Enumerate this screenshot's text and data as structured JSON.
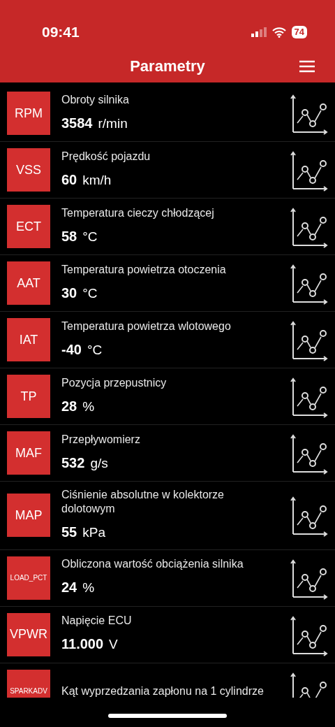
{
  "status_bar": {
    "time": "09:41",
    "battery": "74"
  },
  "header": {
    "title": "Parametry"
  },
  "parameters": [
    {
      "code": "RPM",
      "name": "Obroty silnika",
      "value": "3584",
      "unit": "r/min"
    },
    {
      "code": "VSS",
      "name": "Prędkość pojazdu",
      "value": "60",
      "unit": "km/h"
    },
    {
      "code": "ECT",
      "name": "Temperatura cieczy chłodzącej",
      "value": "58",
      "unit": "°C"
    },
    {
      "code": "AAT",
      "name": "Temperatura powietrza otoczenia",
      "value": "30",
      "unit": "°C"
    },
    {
      "code": "IAT",
      "name": "Temperatura powietrza wlotowego",
      "value": "-40",
      "unit": "°C"
    },
    {
      "code": "TP",
      "name": "Pozycja przepustnicy",
      "value": "28",
      "unit": "%"
    },
    {
      "code": "MAF",
      "name": "Przepływomierz",
      "value": "532",
      "unit": "g/s"
    },
    {
      "code": "MAP",
      "name": "Ciśnienie absolutne w kolektorze dolotowym",
      "value": "55",
      "unit": "kPa"
    },
    {
      "code": "LOAD_PCT",
      "name": "Obliczona wartość obciążenia silnika",
      "value": "24",
      "unit": "%"
    },
    {
      "code": "VPWR",
      "name": "Napięcie ECU",
      "value": "11.000",
      "unit": "V"
    },
    {
      "code": "SPARKADV",
      "name": "Kąt wyprzedzania zapłonu na 1 cylindrze"
    }
  ]
}
